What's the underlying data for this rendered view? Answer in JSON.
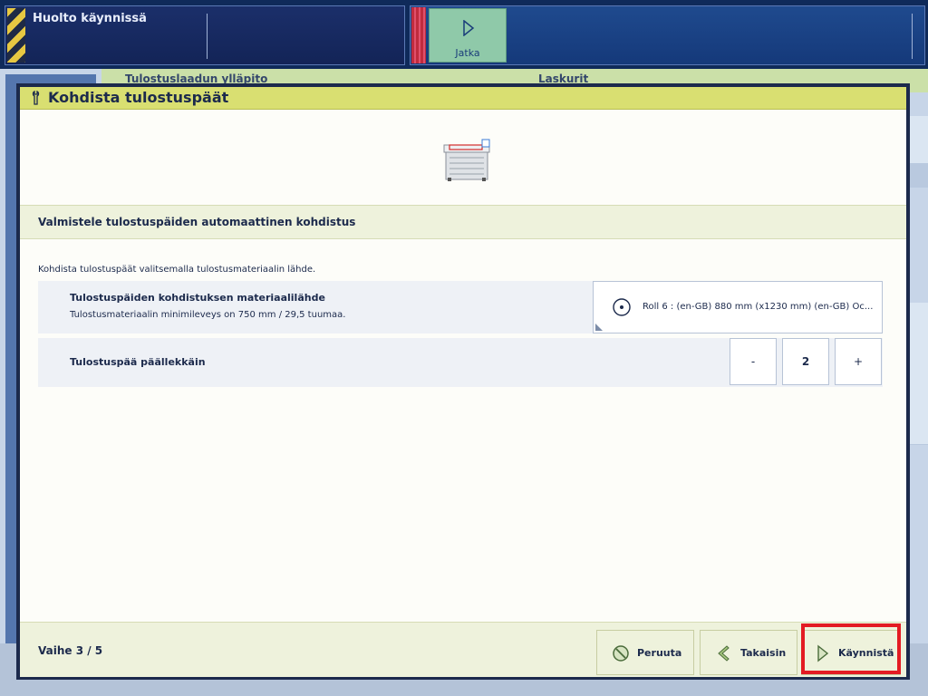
{
  "status": {
    "message": "Huolto käynnissä",
    "continue_label": "Jatka"
  },
  "background": {
    "tab1": "Tulostuslaadun ylläpito",
    "tab2": "Laskurit"
  },
  "dialog": {
    "title": "Kohdista tulostuspäät",
    "section_title": "Valmistele tulostuspäiden automaattinen kohdistus",
    "intro": "Kohdista tulostuspäät valitsemalla tulostusmateriaalin lähde.",
    "media_source": {
      "label": "Tulostuspäiden kohdistuksen materiaalilähde",
      "sublabel": "Tulostusmateriaalin minimileveys on 750 mm / 29,5 tuumaa.",
      "value": "Roll 6 : (en-GB) 880 mm (x1230 mm) (en-GB) Oc..."
    },
    "overlap": {
      "label": "Tulostuspää päällekkäin",
      "minus": "-",
      "value": "2",
      "plus": "+"
    },
    "footer": {
      "step": "Vaihe 3 / 5",
      "cancel": "Peruuta",
      "back": "Takaisin",
      "start": "Käynnistä"
    }
  },
  "colors": {
    "title_bar": "#d9df71",
    "dialog_frame": "#1c2a4c",
    "highlight": "#e31b23",
    "continue_button": "#8fc9a9"
  }
}
